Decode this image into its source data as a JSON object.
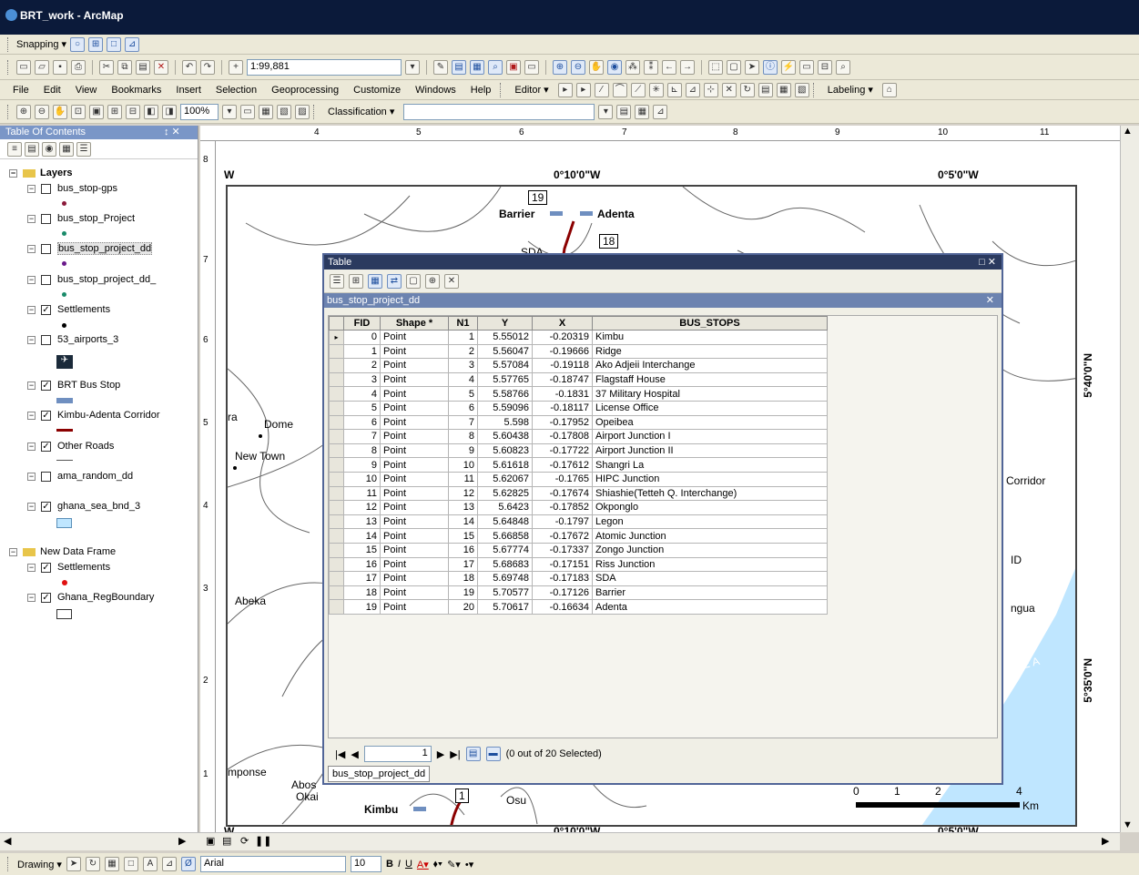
{
  "window": {
    "title": "BRT_work - ArcMap"
  },
  "snapping_bar": {
    "label": "Snapping ▾"
  },
  "standard_bar": {
    "scale": "1:99,881"
  },
  "menu": [
    "File",
    "Edit",
    "View",
    "Bookmarks",
    "Insert",
    "Selection",
    "Geoprocessing",
    "Customize",
    "Windows",
    "Help"
  ],
  "editor": {
    "label": "Editor ▾"
  },
  "labeling": {
    "label": "Labeling ▾"
  },
  "layout_bar": {
    "zoom": "100%",
    "classification": "Classification ▾"
  },
  "toc": {
    "title": "Table Of Contents",
    "pin": "↕ ✕",
    "frame1": "Layers",
    "layers": [
      {
        "name": "bus_stop-gps",
        "checked": false
      },
      {
        "name": "bus_stop_Project",
        "checked": false
      },
      {
        "name": "bus_stop_project_dd",
        "checked": false
      },
      {
        "name": "bus_stop_project_dd_",
        "checked": false
      },
      {
        "name": "Settlements",
        "checked": true
      },
      {
        "name": "53_airports_3",
        "checked": false
      },
      {
        "name": "BRT Bus Stop",
        "checked": true
      },
      {
        "name": "Kimbu-Adenta Corridor",
        "checked": true
      },
      {
        "name": "Other Roads",
        "checked": true
      },
      {
        "name": "ama_random_dd",
        "checked": false
      },
      {
        "name": "ghana_sea_bnd_3",
        "checked": true
      }
    ],
    "frame2": "New Data Frame",
    "frame2_layers": [
      {
        "name": "Settlements",
        "checked": true
      },
      {
        "name": "Ghana_RegBoundary",
        "checked": true
      }
    ]
  },
  "ruler": {
    "top": [
      "4",
      "5",
      "6",
      "7",
      "8",
      "9",
      "10",
      "11"
    ],
    "left": [
      "8",
      "7",
      "6",
      "5",
      "4",
      "3",
      "2",
      "1"
    ]
  },
  "map": {
    "coord_top_left": "W",
    "coord_top_1": "0°10'0\"W",
    "coord_top_2": "0°5'0\"W",
    "coord_bottom_left": "W",
    "coord_bottom_1": "0°10'0\"W",
    "coord_bottom_2": "0°5'0\"W",
    "coord_right_1": "5°40'0\"N",
    "coord_right_2": "5°35'0\"N",
    "labels": {
      "barrier": "Barrier",
      "adenta": "Adenta",
      "n19": "19",
      "n18": "18",
      "sda": "SDA",
      "dome": "Dome",
      "newtown": "New Town",
      "abeka": "Abeka",
      "ra": "ra",
      "mponse": "mponse",
      "abos": "Abos",
      "okai": "Okai",
      "kimbu": "Kimbu",
      "n1": "1",
      "osu": "Osu",
      "corridor": "Corridor",
      "id": "ID",
      "ngua": "ngua",
      "inea": "INEA"
    },
    "scalebar": {
      "ticks": [
        "0",
        "1",
        "2",
        "4"
      ],
      "unit": "Km"
    }
  },
  "table_window": {
    "title": "Table",
    "controls": "□ ✕",
    "tab": "bus_stop_project_dd",
    "columns": [
      "FID",
      "Shape *",
      "N1",
      "Y",
      "X",
      "BUS_STOPS"
    ],
    "rows": [
      [
        "0",
        "Point",
        "1",
        "5.55012",
        "-0.20319",
        "Kimbu"
      ],
      [
        "1",
        "Point",
        "2",
        "5.56047",
        "-0.19666",
        "Ridge"
      ],
      [
        "2",
        "Point",
        "3",
        "5.57084",
        "-0.19118",
        "Ako Adjeii Interchange"
      ],
      [
        "3",
        "Point",
        "4",
        "5.57765",
        "-0.18747",
        "Flagstaff House"
      ],
      [
        "4",
        "Point",
        "5",
        "5.58766",
        "-0.1831",
        "37 Military Hospital"
      ],
      [
        "5",
        "Point",
        "6",
        "5.59096",
        "-0.18117",
        "License Office"
      ],
      [
        "6",
        "Point",
        "7",
        "5.598",
        "-0.17952",
        "Opeibea"
      ],
      [
        "7",
        "Point",
        "8",
        "5.60438",
        "-0.17808",
        "Airport Junction I"
      ],
      [
        "8",
        "Point",
        "9",
        "5.60823",
        "-0.17722",
        "Airport Junction II"
      ],
      [
        "9",
        "Point",
        "10",
        "5.61618",
        "-0.17612",
        "Shangri La"
      ],
      [
        "10",
        "Point",
        "11",
        "5.62067",
        "-0.1765",
        "HIPC Junction"
      ],
      [
        "11",
        "Point",
        "12",
        "5.62825",
        "-0.17674",
        "Shiashie(Tetteh Q. Interchange)"
      ],
      [
        "12",
        "Point",
        "13",
        "5.6423",
        "-0.17852",
        "Okponglo"
      ],
      [
        "13",
        "Point",
        "14",
        "5.64848",
        "-0.1797",
        "Legon"
      ],
      [
        "14",
        "Point",
        "15",
        "5.66858",
        "-0.17672",
        "Atomic Junction"
      ],
      [
        "15",
        "Point",
        "16",
        "5.67774",
        "-0.17337",
        "Zongo Junction"
      ],
      [
        "16",
        "Point",
        "17",
        "5.68683",
        "-0.17151",
        "Riss Junction"
      ],
      [
        "17",
        "Point",
        "18",
        "5.69748",
        "-0.17183",
        "SDA"
      ],
      [
        "18",
        "Point",
        "19",
        "5.70577",
        "-0.17126",
        "Barrier"
      ],
      [
        "19",
        "Point",
        "20",
        "5.70617",
        "-0.16634",
        "Adenta"
      ]
    ],
    "record": "1",
    "selection_status": "(0 out of 20 Selected)",
    "bottom_tab": "bus_stop_project_dd"
  },
  "drawing_bar": {
    "label": "Drawing ▾",
    "font": "Arial",
    "size": "10",
    "bold": "B",
    "italic": "I",
    "underline": "U"
  },
  "colors": {
    "title_bg": "#0b1a3a",
    "route": "#8b0000",
    "sea": "#bfe6ff",
    "toc_header": "#7a96c7"
  }
}
